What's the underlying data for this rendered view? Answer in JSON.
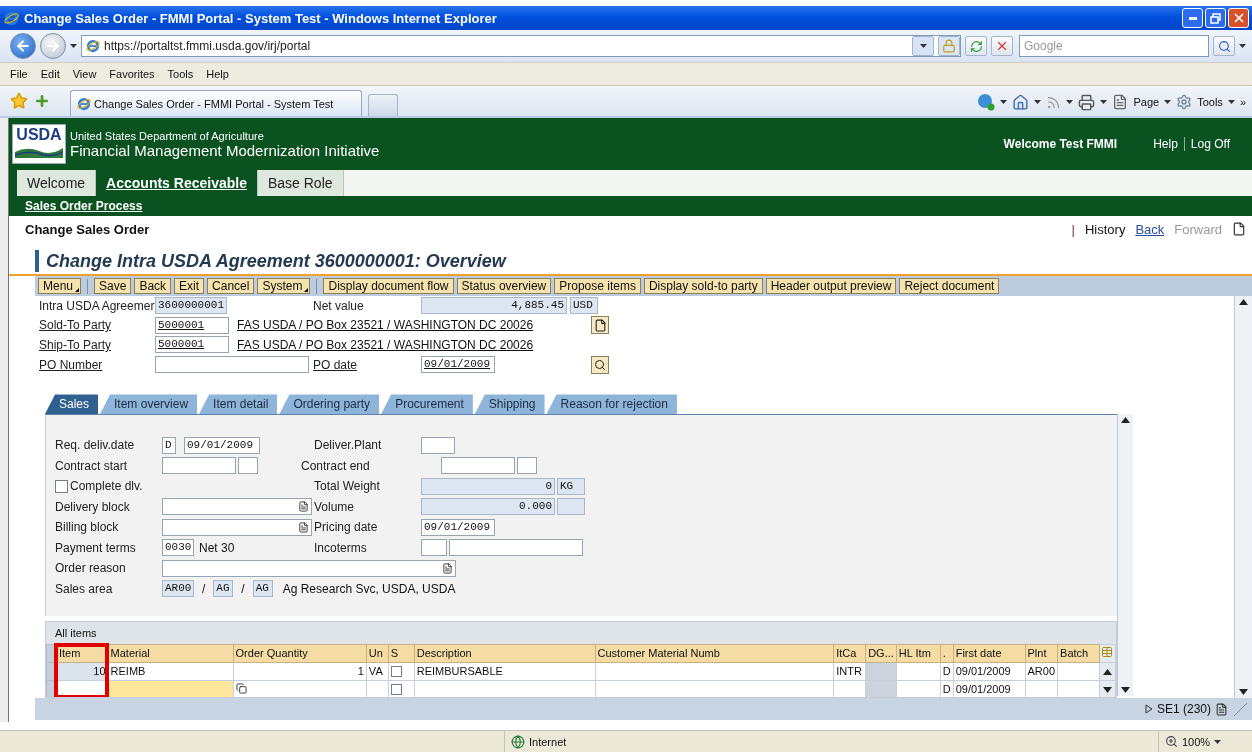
{
  "browser": {
    "title": "Change Sales Order - FMMI Portal - System Test - Windows Internet Explorer",
    "address": "https://portaltst.fmmi.usda.gov/irj/portal",
    "search_placeholder": "Google",
    "menu": [
      "File",
      "Edit",
      "View",
      "Favorites",
      "Tools",
      "Help"
    ],
    "tab_title": "Change Sales Order - FMMI Portal - System Test",
    "commands": [
      "Page",
      "Tools"
    ],
    "more": "»"
  },
  "portal": {
    "logo": "USDA",
    "department": "United States Department of Agriculture",
    "application": "Financial Management Modernization Initiative",
    "welcome": "Welcome Test FMMI",
    "links": [
      "Help",
      "Log Off"
    ],
    "nav": [
      {
        "label": "Welcome",
        "selected": false
      },
      {
        "label": "Accounts Receivable",
        "selected": true
      },
      {
        "label": "Base Role",
        "selected": false
      }
    ],
    "subnav": "Sales Order Process",
    "page_title": "Change Sales Order",
    "history": {
      "separator": "|",
      "label": "History",
      "back": "Back",
      "forward": "Forward",
      "back_enabled": true,
      "forward_enabled": false
    }
  },
  "transaction": {
    "title": "Change Intra USDA Agreement 3600000001: Overview",
    "toolbar": [
      {
        "label": "Menu",
        "kind": "menu"
      },
      {
        "label": "Save",
        "kind": "button"
      },
      {
        "label": "Back",
        "kind": "button"
      },
      {
        "label": "Exit",
        "kind": "button"
      },
      {
        "label": "Cancel",
        "kind": "button"
      },
      {
        "label": "System",
        "kind": "menu"
      },
      {
        "label": "Display document flow",
        "kind": "button"
      },
      {
        "label": "Status overview",
        "kind": "button"
      },
      {
        "label": "Propose items",
        "kind": "button"
      },
      {
        "label": "Display sold-to party",
        "kind": "button"
      },
      {
        "label": "Header output preview",
        "kind": "button"
      },
      {
        "label": "Reject document",
        "kind": "button"
      }
    ],
    "header": {
      "agreement": {
        "label": "Intra USDA Agreemer",
        "value": "3600000001"
      },
      "net_value": {
        "label": "Net value",
        "value": "4,885.45",
        "currency": "USD"
      },
      "sold_to": {
        "label": "Sold-To Party",
        "value": "5000001",
        "address": "FAS USDA / PO Box 23521 / WASHINGTON DC 20026"
      },
      "ship_to": {
        "label": "Ship-To Party",
        "value": "5000001",
        "address": "FAS USDA / PO Box 23521 / WASHINGTON DC 20026"
      },
      "po_number": {
        "label": "PO Number"
      },
      "po_date": {
        "label": "PO date",
        "value": "09/01/2009"
      }
    },
    "tabs": [
      {
        "label": "Sales",
        "selected": true
      },
      {
        "label": "Item overview",
        "selected": false
      },
      {
        "label": "Item detail",
        "selected": false
      },
      {
        "label": "Ordering party",
        "selected": false
      },
      {
        "label": "Procurement",
        "selected": false
      },
      {
        "label": "Shipping",
        "selected": false
      },
      {
        "label": "Reason for rejection",
        "selected": false
      }
    ],
    "form": {
      "req_deliv_date": {
        "label": "Req. deliv.date",
        "period": "D",
        "value": "09/01/2009"
      },
      "deliver_plant": {
        "label": "Deliver.Plant"
      },
      "contract_start": {
        "label": "Contract start"
      },
      "contract_end": {
        "label": "Contract end"
      },
      "complete_dlv": {
        "label": "Complete dlv.",
        "checked": false
      },
      "total_weight": {
        "label": "Total Weight",
        "value": "0",
        "unit": "KG"
      },
      "delivery_block": {
        "label": "Delivery block"
      },
      "volume": {
        "label": "Volume",
        "value": "0.000"
      },
      "billing_block": {
        "label": "Billing block"
      },
      "pricing_date": {
        "label": "Pricing date",
        "value": "09/01/2009"
      },
      "payment_terms": {
        "label": "Payment terms",
        "value": "0030",
        "text": "Net 30"
      },
      "incoterms": {
        "label": "Incoterms"
      },
      "order_reason": {
        "label": "Order reason"
      },
      "sales_area": {
        "label": "Sales area",
        "parts": [
          "AR00",
          "AG",
          "AG"
        ],
        "separators": [
          "/",
          "/"
        ],
        "text": "Ag Research Svc, USDA, USDA"
      }
    },
    "items": {
      "title": "All items",
      "columns": [
        {
          "label": "Item",
          "kind": "key",
          "highlighted": true
        },
        {
          "label": "Material",
          "kind": "text"
        },
        {
          "label": "Order Quantity",
          "kind": "number"
        },
        {
          "label": "Un",
          "kind": "text"
        },
        {
          "label": "S",
          "kind": "checkbox"
        },
        {
          "label": "Description",
          "kind": "text"
        },
        {
          "label": "Customer Material Numb",
          "kind": "text"
        },
        {
          "label": "ItCa",
          "kind": "text"
        },
        {
          "label": "DG...",
          "kind": "locked"
        },
        {
          "label": "HL Itm",
          "kind": "text"
        },
        {
          "label": ".",
          "kind": "text"
        },
        {
          "label": "First date",
          "kind": "text"
        },
        {
          "label": "Plnt",
          "kind": "text"
        },
        {
          "label": "Batch",
          "kind": "text"
        }
      ],
      "rows": [
        {
          "kind": "item",
          "item": "10",
          "material": "REIMB",
          "quantity": "1",
          "unit": "VA",
          "s": false,
          "description": "REIMBURSABLE",
          "itca": "INTR",
          "column_11": "D",
          "first_date": "09/01/2009",
          "plant": "AR00"
        },
        {
          "kind": "new",
          "s": false,
          "column_11": "D",
          "first_date": "09/01/2009"
        }
      ]
    },
    "status": {
      "session": "SE1 (230)"
    }
  },
  "ie_status": {
    "zone": "Internet",
    "zoom": "100%"
  }
}
